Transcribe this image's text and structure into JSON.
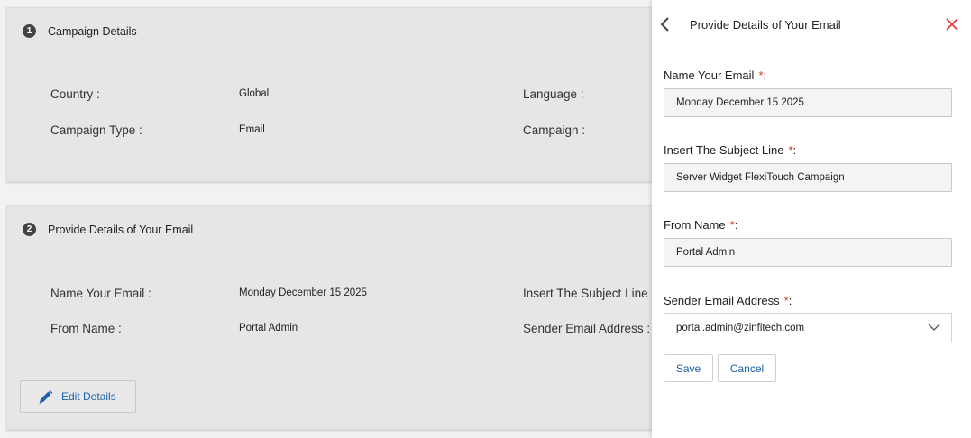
{
  "section1": {
    "step": "1",
    "title": "Campaign Details",
    "fields": [
      {
        "label": "Country :",
        "value": "Global"
      },
      {
        "label": "Campaign Type :",
        "value": "Email"
      },
      {
        "label": "Language :"
      },
      {
        "label": "Campaign :"
      }
    ]
  },
  "section2": {
    "step": "2",
    "title": "Provide Details of Your Email",
    "fields": [
      {
        "label": "Name Your Email :",
        "value": "Monday December 15 2025"
      },
      {
        "label": "From Name :",
        "value": "Portal Admin"
      },
      {
        "label": "Insert The Subject Line"
      },
      {
        "label": "Sender Email Address :"
      }
    ],
    "edit_label": "Edit Details"
  },
  "drawer": {
    "title": "Provide Details of Your Email",
    "required_mark": "*",
    "colon": ":",
    "name_email": {
      "label": "Name Your Email",
      "value": "Monday December 15 2025"
    },
    "subject_line": {
      "label": "Insert The Subject Line",
      "value": "Server Widget FlexiTouch Campaign"
    },
    "from_name": {
      "label": "From Name",
      "value": "Portal Admin"
    },
    "sender_email": {
      "label": "Sender Email Address",
      "value": "portal.admin@zinfitech.com"
    },
    "save_label": "Save",
    "cancel_label": "Cancel"
  },
  "colors": {
    "accent": "#1d5fa8",
    "required": "#d0342c",
    "close": "#e03a3a"
  },
  "icons": {
    "back": "chevron-left-icon",
    "close": "close-icon",
    "edit": "pencil-icon",
    "dropdown": "chevron-down-icon"
  }
}
